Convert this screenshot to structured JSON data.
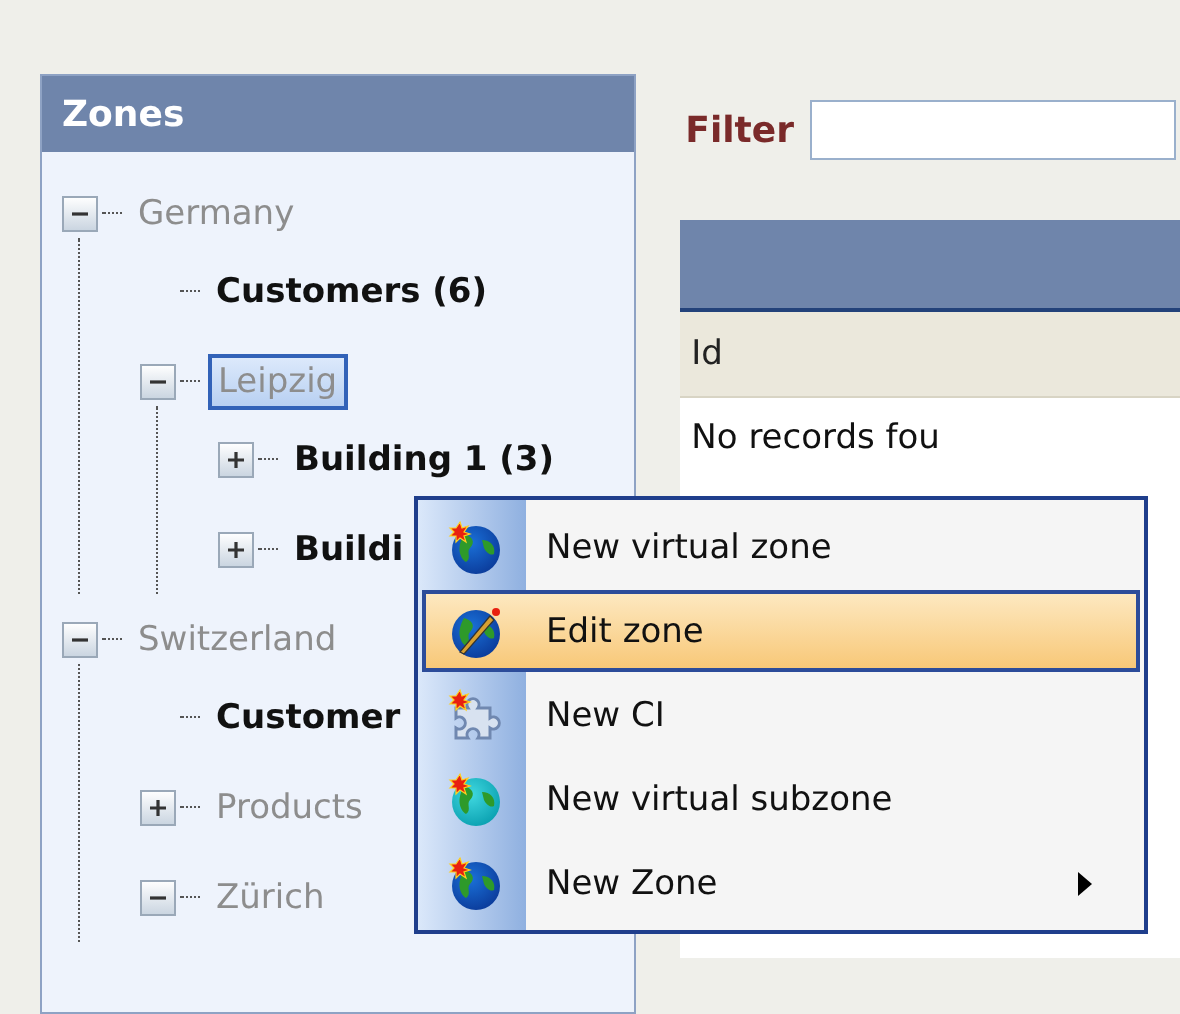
{
  "zones_panel": {
    "title": "Zones",
    "tree": [
      {
        "label": "Germany",
        "kind": "zone",
        "expanded": true,
        "selected": false,
        "children": [
          {
            "label": "Customers (6)",
            "kind": "group",
            "selected": false
          },
          {
            "label": "Leipzig",
            "kind": "zone",
            "expanded": true,
            "selected": true,
            "children": [
              {
                "label": "Building 1 (3)",
                "kind": "group",
                "expanded": false,
                "selected": false
              },
              {
                "label": "Buildi",
                "kind": "group",
                "expanded": false,
                "selected": false
              }
            ]
          }
        ]
      },
      {
        "label": "Switzerland",
        "kind": "zone",
        "expanded": true,
        "selected": false,
        "children": [
          {
            "label": "Customer",
            "kind": "group",
            "selected": false
          },
          {
            "label": "Products",
            "kind": "zone",
            "expanded": false,
            "selected": false
          },
          {
            "label": "Zürich",
            "kind": "zone",
            "expanded": true,
            "selected": false
          }
        ]
      }
    ]
  },
  "filter": {
    "label": "Filter"
  },
  "grid": {
    "columns": [
      "Id"
    ],
    "empty_message": "No records fou"
  },
  "context_menu": {
    "items": [
      {
        "label": "New virtual zone",
        "kind": "new-zone",
        "selected": false,
        "has_submenu": false
      },
      {
        "label": "Edit zone",
        "kind": "edit-zone",
        "selected": true,
        "has_submenu": false
      },
      {
        "label": "New CI",
        "kind": "new-ci",
        "selected": false,
        "has_submenu": false
      },
      {
        "label": "New virtual subzone",
        "kind": "new-subzone",
        "selected": false,
        "has_submenu": false
      },
      {
        "label": "New Zone",
        "kind": "new-zone",
        "selected": false,
        "has_submenu": true
      }
    ]
  }
}
